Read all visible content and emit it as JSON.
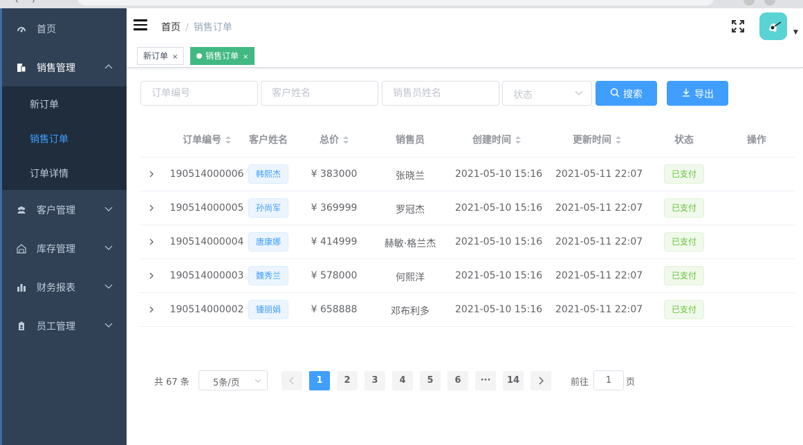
{
  "sidebar": {
    "items": [
      {
        "label": "首页",
        "icon": "dashboard-icon"
      },
      {
        "label": "销售管理",
        "icon": "sales-icon",
        "expanded": true,
        "children": [
          {
            "label": "新订单"
          },
          {
            "label": "销售订单",
            "active": true
          },
          {
            "label": "订单详情"
          }
        ]
      },
      {
        "label": "客户管理",
        "icon": "customers-icon"
      },
      {
        "label": "库存管理",
        "icon": "warehouse-icon"
      },
      {
        "label": "财务报表",
        "icon": "bar-chart-icon"
      },
      {
        "label": "员工管理",
        "icon": "employee-badge-icon"
      }
    ]
  },
  "navbar": {
    "breadcrumb": {
      "home": "首页",
      "separator": "/",
      "current": "销售订单"
    }
  },
  "tags": [
    {
      "label": "新订单",
      "close": "×",
      "active": false
    },
    {
      "label": "销售订单",
      "close": "×",
      "active": true
    }
  ],
  "filters": {
    "order_no_placeholder": "订单编号",
    "customer_placeholder": "客户姓名",
    "salesperson_placeholder": "销售员姓名",
    "status_placeholder": "状态",
    "search_label": "搜索",
    "export_label": "导出"
  },
  "table": {
    "headers": {
      "order_no": "订单编号",
      "customer": "客户姓名",
      "total": "总价",
      "salesperson": "销售员",
      "created": "创建时间",
      "updated": "更新时间",
      "status": "状态",
      "actions": "操作"
    },
    "rows": [
      {
        "order_no": "190514000006",
        "customer": "韩熙杰",
        "total": "¥ 383000",
        "salesperson": "张晓兰",
        "created": "2021-05-10 15:16",
        "updated": "2021-05-11 22:07",
        "status": "已支付"
      },
      {
        "order_no": "190514000005",
        "customer": "孙尚军",
        "total": "¥ 369999",
        "salesperson": "罗冠杰",
        "created": "2021-05-10 15:16",
        "updated": "2021-05-11 22:07",
        "status": "已支付"
      },
      {
        "order_no": "190514000004",
        "customer": "唐康娜",
        "total": "¥ 414999",
        "salesperson": "赫敏·格兰杰",
        "created": "2021-05-10 15:16",
        "updated": "2021-05-11 22:07",
        "status": "已支付"
      },
      {
        "order_no": "190514000003",
        "customer": "魏秀兰",
        "total": "¥ 578000",
        "salesperson": "何熙洋",
        "created": "2021-05-10 15:16",
        "updated": "2021-05-11 22:07",
        "status": "已支付"
      },
      {
        "order_no": "190514000002",
        "customer": "锺丽娟",
        "total": "¥ 658888",
        "salesperson": "邓布利多",
        "created": "2021-05-10 15:16",
        "updated": "2021-05-11 22:07",
        "status": "已支付"
      }
    ]
  },
  "pagination": {
    "total": "共 67 条",
    "page_size": "5条/页",
    "pages": [
      "1",
      "2",
      "3",
      "4",
      "5",
      "6",
      "···",
      "14"
    ],
    "current": "1",
    "jump_prefix": "前往",
    "jump_value": "1",
    "jump_suffix": "页"
  },
  "colors": {
    "sidebar_bg": "#304156",
    "submenu_bg": "#1f2d3d",
    "active_text": "#409eff",
    "primary": "#409eff",
    "tag_active": "#42b983",
    "status_success": "#67c23a"
  }
}
